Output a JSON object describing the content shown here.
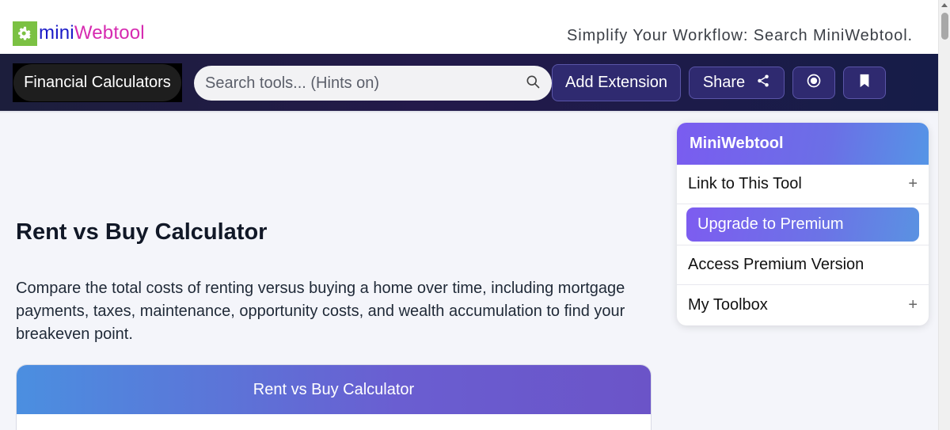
{
  "header": {
    "logo_mini": "mini",
    "logo_web": "Webtool",
    "tagline": "Simplify Your Workflow: Search MiniWebtool."
  },
  "nav": {
    "category_label": "Financial Calculators",
    "search_placeholder": "Search tools... (Hints on)",
    "add_extension_label": "Add Extension",
    "share_label": "Share"
  },
  "main": {
    "title": "Rent vs Buy Calculator",
    "description": "Compare the total costs of renting versus buying a home over time, including mortgage payments, taxes, maintenance, opportunity costs, and wealth accumulation to find your breakeven point.",
    "calculator_header": "Rent vs Buy Calculator"
  },
  "sidebar": {
    "title": "MiniWebtool",
    "items": [
      {
        "label": "Link to This Tool",
        "expand": "+"
      },
      {
        "label": "Upgrade to Premium"
      },
      {
        "label": "Access Premium Version"
      },
      {
        "label": "My Toolbox",
        "expand": "+"
      }
    ]
  },
  "icons": {
    "logo": "gear-icon",
    "search": "search-icon",
    "share": "share-icon",
    "record": "record-icon",
    "bookmark": "bookmark-icon"
  },
  "colors": {
    "logo_gear": "#7bc143",
    "logo_mini": "#1a1ac7",
    "logo_web": "#d62ab0",
    "nav_bg": "#1c1e3c",
    "accent_blue": "#4b8fe0",
    "accent_purple": "#6b54c8"
  }
}
